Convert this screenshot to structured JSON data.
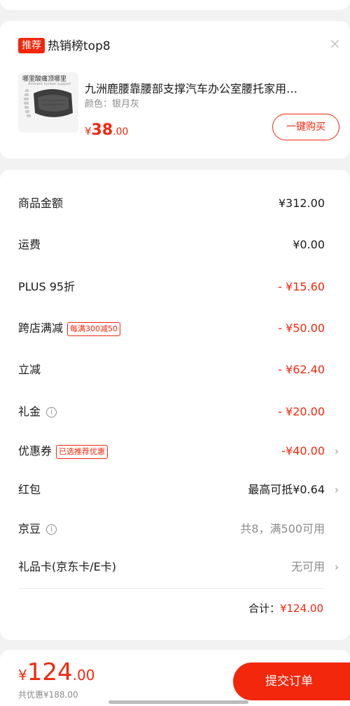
{
  "recommend": {
    "badge": "推荐",
    "title": "热销榜top8",
    "close_icon": "×",
    "product": {
      "image_caption": "哪里酸痛顶哪里",
      "image_caption_small": "Ambient lumbar support",
      "name": "九洲鹿腰靠腰部支撑汽车办公室腰托家用…",
      "spec": "颜色：银月灰",
      "price_currency": "¥",
      "price_int": "38",
      "price_dec": ".00",
      "buy_label": "一键购买"
    }
  },
  "summary": {
    "rows": [
      {
        "label": "商品金额",
        "value": "¥312.00"
      },
      {
        "label": "运费",
        "value": "¥0.00"
      },
      {
        "label": "PLUS 95折",
        "value": "- ¥15.60"
      },
      {
        "label": "跨店满减",
        "tag": "每满300减50",
        "value": "- ¥50.00"
      },
      {
        "label": "立减",
        "value": "- ¥62.40"
      },
      {
        "label": "礼金",
        "info_icon": "i",
        "value": "- ¥20.00"
      },
      {
        "label": "优惠券",
        "tag": "已选推荐优惠",
        "value": "-¥40.00"
      },
      {
        "label": "红包",
        "value": "最高可抵¥0.64"
      },
      {
        "label": "京豆",
        "info_icon": "i",
        "value": "共8，满500可用"
      },
      {
        "label": "礼品卡(京东卡/E卡)",
        "value": "无可用"
      }
    ],
    "arrow": "›",
    "total_label": "合计：",
    "total_value": "¥124.00"
  },
  "bottom": {
    "price_currency": "¥",
    "price_int": "124",
    "price_dec": ".00",
    "saved": "共优惠¥188.00",
    "submit_label": "提交订单"
  },
  "colors": {
    "accent": "#f2270c",
    "text": "#1a1a1a",
    "muted": "#8c8c8c",
    "background": "#f2f2f2"
  }
}
